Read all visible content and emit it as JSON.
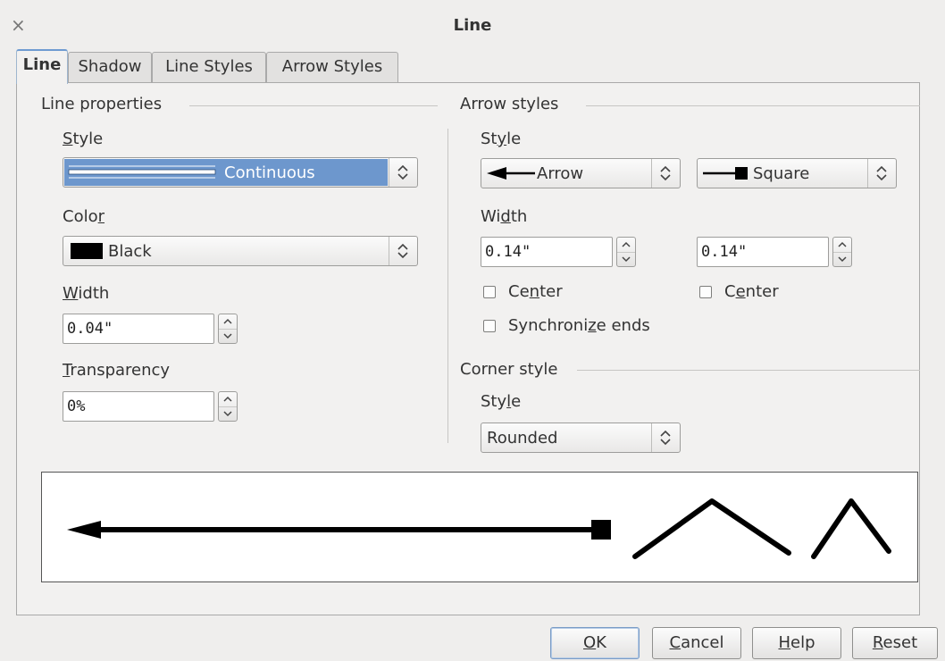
{
  "window": {
    "title": "Line",
    "close_glyph": "×"
  },
  "tabs": [
    {
      "label": "Line",
      "active": true
    },
    {
      "label": "Shadow",
      "active": false
    },
    {
      "label": "Line Styles",
      "active": false
    },
    {
      "label": "Arrow Styles",
      "active": false
    }
  ],
  "line_properties": {
    "title": "Line properties",
    "style_label_pre": "",
    "style_label_u": "S",
    "style_label_post": "tyle",
    "style_value": "Continuous",
    "color_label_pre": "Colo",
    "color_label_u": "r",
    "color_label_post": "",
    "color_value": "Black",
    "color_swatch": "#000000",
    "width_label_pre": "",
    "width_label_u": "W",
    "width_label_post": "idth",
    "width_value": "0.04\"",
    "transparency_label_pre": "",
    "transparency_label_u": "T",
    "transparency_label_post": "ransparency",
    "transparency_value": "0%"
  },
  "arrow_styles": {
    "title": "Arrow styles",
    "style_label_pre": "St",
    "style_label_u": "y",
    "style_label_post": "le",
    "start_style": "Arrow",
    "end_style": "Square",
    "width_label_pre": "Wi",
    "width_label_u": "d",
    "width_label_post": "th",
    "start_width": "0.14\"",
    "end_width": "0.14\"",
    "center_start_pre": "Ce",
    "center_start_u": "n",
    "center_start_post": "ter",
    "center_start_checked": false,
    "center_end_pre": "C",
    "center_end_u": "e",
    "center_end_post": "nter",
    "center_end_checked": false,
    "sync_pre": "Synchroni",
    "sync_u": "z",
    "sync_post": "e ends",
    "sync_checked": false
  },
  "corner_style": {
    "title": "Corner style",
    "style_label_pre": "Sty",
    "style_label_u": "l",
    "style_label_post": "e",
    "style_value": "Rounded"
  },
  "buttons": {
    "ok_u": "O",
    "ok_post": "K",
    "cancel_u": "C",
    "cancel_post": "ancel",
    "help_u": "H",
    "help_post": "elp",
    "reset_u": "R",
    "reset_post": "eset"
  },
  "colors": {
    "selection": "#6d97cd",
    "accent": "#6e9bd1"
  }
}
